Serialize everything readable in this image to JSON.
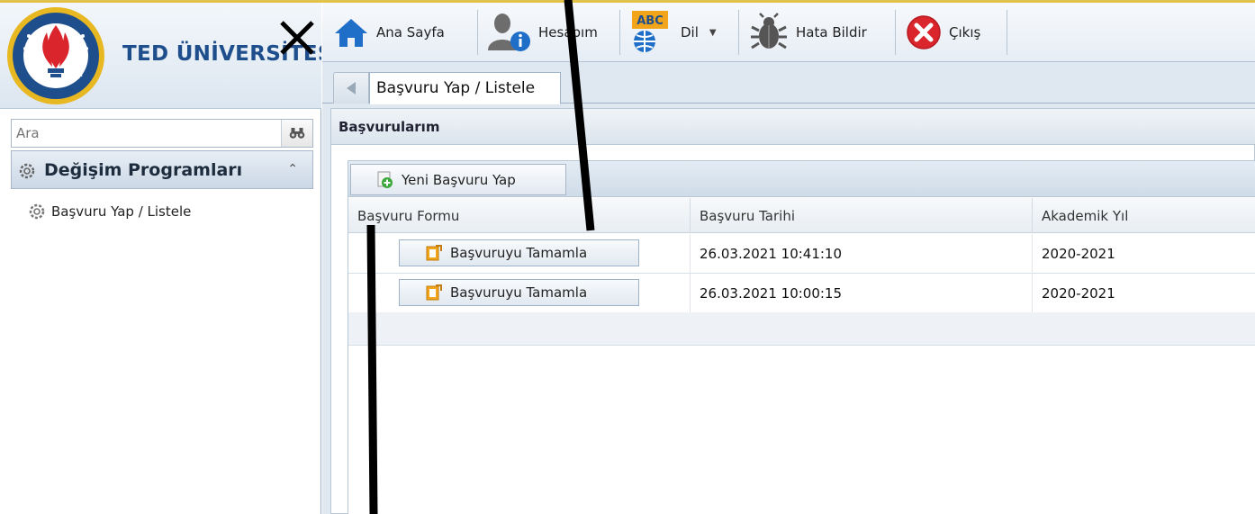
{
  "brand": {
    "name": "TED ÜNİVERSİTESİ",
    "seal_text": "TED ÜNİVERSİTESİ"
  },
  "sidebar": {
    "search_placeholder": "Ara",
    "group_title": "Değişim Programları",
    "items": [
      {
        "label": "Başvuru Yap / Listele"
      }
    ]
  },
  "toolbar": {
    "items": [
      {
        "label": "Ana Sayfa",
        "icon": "home-icon"
      },
      {
        "label": "Hesabım",
        "icon": "account-icon"
      },
      {
        "label": "Dil",
        "icon": "language-icon",
        "icon_text": "ABC"
      },
      {
        "label": "Hata Bildir",
        "icon": "bug-icon"
      },
      {
        "label": "Çıkış",
        "icon": "exit-icon"
      }
    ]
  },
  "tabs": [
    {
      "label": "Başvuru Yap / Listele",
      "active": true
    }
  ],
  "panel": {
    "title": "Başvurularım",
    "new_button_label": "Yeni Başvuru Yap",
    "columns": [
      "Başvuru Formu",
      "Başvuru Tarihi",
      "Akademik Yıl"
    ],
    "rows": [
      {
        "action_label": "Başvuruyu Tamamla",
        "date": "26.03.2021 10:41:10",
        "year": "2020-2021"
      },
      {
        "action_label": "Başvuruyu Tamamla",
        "date": "26.03.2021 10:00:15",
        "year": "2020-2021"
      }
    ]
  },
  "colors": {
    "brand_blue": "#1f4e8c",
    "accent_yellow": "#e3c24a",
    "exit_red": "#d9252b",
    "home_blue": "#1f6fc9"
  }
}
